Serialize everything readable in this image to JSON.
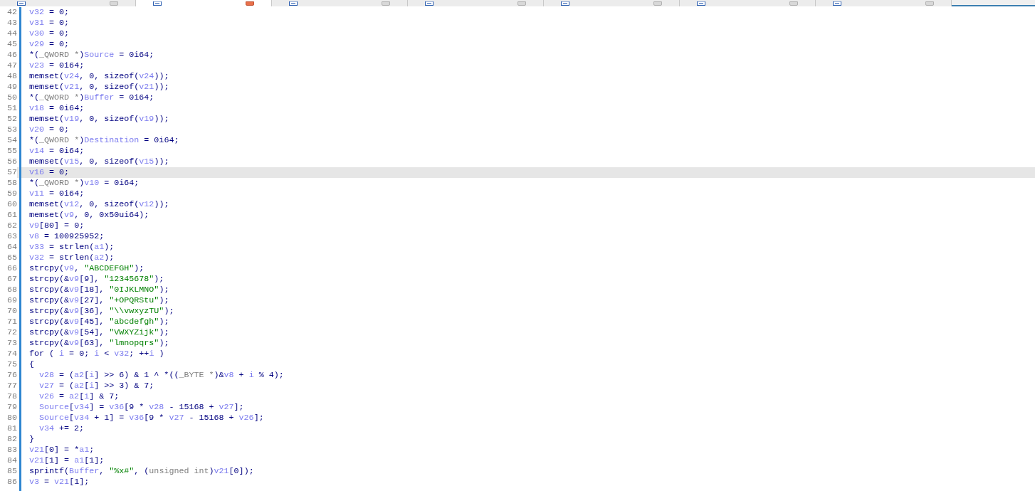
{
  "tabs": [
    {
      "selected": false
    },
    {
      "selected": true
    },
    {
      "selected": false
    },
    {
      "selected": false
    },
    {
      "selected": false
    },
    {
      "selected": false
    },
    {
      "selected": false
    }
  ],
  "lines": [
    {
      "number": "42",
      "highlighted": false,
      "tokens": [
        {
          "kind": "var",
          "text": "v32"
        },
        {
          "kind": "plain",
          "text": " = 0;"
        }
      ]
    },
    {
      "number": "43",
      "highlighted": false,
      "tokens": [
        {
          "kind": "var",
          "text": "v31"
        },
        {
          "kind": "plain",
          "text": " = 0;"
        }
      ]
    },
    {
      "number": "44",
      "highlighted": false,
      "tokens": [
        {
          "kind": "var",
          "text": "v30"
        },
        {
          "kind": "plain",
          "text": " = 0;"
        }
      ]
    },
    {
      "number": "45",
      "highlighted": false,
      "tokens": [
        {
          "kind": "var",
          "text": "v29"
        },
        {
          "kind": "plain",
          "text": " = 0;"
        }
      ]
    },
    {
      "number": "46",
      "highlighted": false,
      "tokens": [
        {
          "kind": "plain",
          "text": "*("
        },
        {
          "kind": "type",
          "text": "_QWORD *"
        },
        {
          "kind": "plain",
          "text": ")"
        },
        {
          "kind": "var",
          "text": "Source"
        },
        {
          "kind": "plain",
          "text": " = 0i64;"
        }
      ]
    },
    {
      "number": "47",
      "highlighted": false,
      "tokens": [
        {
          "kind": "var",
          "text": "v23"
        },
        {
          "kind": "plain",
          "text": " = 0i64;"
        }
      ]
    },
    {
      "number": "48",
      "highlighted": false,
      "tokens": [
        {
          "kind": "plain",
          "text": "memset("
        },
        {
          "kind": "var",
          "text": "v24"
        },
        {
          "kind": "plain",
          "text": ", 0, sizeof("
        },
        {
          "kind": "var",
          "text": "v24"
        },
        {
          "kind": "plain",
          "text": "));"
        }
      ]
    },
    {
      "number": "49",
      "highlighted": false,
      "tokens": [
        {
          "kind": "plain",
          "text": "memset("
        },
        {
          "kind": "var",
          "text": "v21"
        },
        {
          "kind": "plain",
          "text": ", 0, sizeof("
        },
        {
          "kind": "var",
          "text": "v21"
        },
        {
          "kind": "plain",
          "text": "));"
        }
      ]
    },
    {
      "number": "50",
      "highlighted": false,
      "tokens": [
        {
          "kind": "plain",
          "text": "*("
        },
        {
          "kind": "type",
          "text": "_QWORD *"
        },
        {
          "kind": "plain",
          "text": ")"
        },
        {
          "kind": "var",
          "text": "Buffer"
        },
        {
          "kind": "plain",
          "text": " = 0i64;"
        }
      ]
    },
    {
      "number": "51",
      "highlighted": false,
      "tokens": [
        {
          "kind": "var",
          "text": "v18"
        },
        {
          "kind": "plain",
          "text": " = 0i64;"
        }
      ]
    },
    {
      "number": "52",
      "highlighted": false,
      "tokens": [
        {
          "kind": "plain",
          "text": "memset("
        },
        {
          "kind": "var",
          "text": "v19"
        },
        {
          "kind": "plain",
          "text": ", 0, sizeof("
        },
        {
          "kind": "var",
          "text": "v19"
        },
        {
          "kind": "plain",
          "text": "));"
        }
      ]
    },
    {
      "number": "53",
      "highlighted": false,
      "tokens": [
        {
          "kind": "var",
          "text": "v20"
        },
        {
          "kind": "plain",
          "text": " = 0;"
        }
      ]
    },
    {
      "number": "54",
      "highlighted": false,
      "tokens": [
        {
          "kind": "plain",
          "text": "*("
        },
        {
          "kind": "type",
          "text": "_QWORD *"
        },
        {
          "kind": "plain",
          "text": ")"
        },
        {
          "kind": "var",
          "text": "Destination"
        },
        {
          "kind": "plain",
          "text": " = 0i64;"
        }
      ]
    },
    {
      "number": "55",
      "highlighted": false,
      "tokens": [
        {
          "kind": "var",
          "text": "v14"
        },
        {
          "kind": "plain",
          "text": " = 0i64;"
        }
      ]
    },
    {
      "number": "56",
      "highlighted": false,
      "tokens": [
        {
          "kind": "plain",
          "text": "memset("
        },
        {
          "kind": "var",
          "text": "v15"
        },
        {
          "kind": "plain",
          "text": ", 0, sizeof("
        },
        {
          "kind": "var",
          "text": "v15"
        },
        {
          "kind": "plain",
          "text": "));"
        }
      ]
    },
    {
      "number": "57",
      "highlighted": true,
      "tokens": [
        {
          "kind": "var",
          "text": "v16"
        },
        {
          "kind": "plain",
          "text": " = 0;"
        }
      ]
    },
    {
      "number": "58",
      "highlighted": false,
      "tokens": [
        {
          "kind": "plain",
          "text": "*("
        },
        {
          "kind": "type",
          "text": "_QWORD *"
        },
        {
          "kind": "plain",
          "text": ")"
        },
        {
          "kind": "var",
          "text": "v10"
        },
        {
          "kind": "plain",
          "text": " = 0i64;"
        }
      ]
    },
    {
      "number": "59",
      "highlighted": false,
      "tokens": [
        {
          "kind": "var",
          "text": "v11"
        },
        {
          "kind": "plain",
          "text": " = 0i64;"
        }
      ]
    },
    {
      "number": "60",
      "highlighted": false,
      "tokens": [
        {
          "kind": "plain",
          "text": "memset("
        },
        {
          "kind": "var",
          "text": "v12"
        },
        {
          "kind": "plain",
          "text": ", 0, sizeof("
        },
        {
          "kind": "var",
          "text": "v12"
        },
        {
          "kind": "plain",
          "text": "));"
        }
      ]
    },
    {
      "number": "61",
      "highlighted": false,
      "tokens": [
        {
          "kind": "plain",
          "text": "memset("
        },
        {
          "kind": "var",
          "text": "v9"
        },
        {
          "kind": "plain",
          "text": ", 0, 0x50ui64);"
        }
      ]
    },
    {
      "number": "62",
      "highlighted": false,
      "tokens": [
        {
          "kind": "var",
          "text": "v9"
        },
        {
          "kind": "plain",
          "text": "[80] = 0;"
        }
      ]
    },
    {
      "number": "63",
      "highlighted": false,
      "tokens": [
        {
          "kind": "var",
          "text": "v8"
        },
        {
          "kind": "plain",
          "text": " = 100925952;"
        }
      ]
    },
    {
      "number": "64",
      "highlighted": false,
      "tokens": [
        {
          "kind": "var",
          "text": "v33"
        },
        {
          "kind": "plain",
          "text": " = strlen("
        },
        {
          "kind": "var",
          "text": "a1"
        },
        {
          "kind": "plain",
          "text": ");"
        }
      ]
    },
    {
      "number": "65",
      "highlighted": false,
      "tokens": [
        {
          "kind": "var",
          "text": "v32"
        },
        {
          "kind": "plain",
          "text": " = strlen("
        },
        {
          "kind": "var",
          "text": "a2"
        },
        {
          "kind": "plain",
          "text": ");"
        }
      ]
    },
    {
      "number": "66",
      "highlighted": false,
      "tokens": [
        {
          "kind": "plain",
          "text": "strcpy("
        },
        {
          "kind": "var",
          "text": "v9"
        },
        {
          "kind": "plain",
          "text": ", "
        },
        {
          "kind": "str",
          "text": "\"ABCDEFGH\""
        },
        {
          "kind": "plain",
          "text": ");"
        }
      ]
    },
    {
      "number": "67",
      "highlighted": false,
      "tokens": [
        {
          "kind": "plain",
          "text": "strcpy(&"
        },
        {
          "kind": "var",
          "text": "v9"
        },
        {
          "kind": "plain",
          "text": "[9], "
        },
        {
          "kind": "str",
          "text": "\"12345678\""
        },
        {
          "kind": "plain",
          "text": ");"
        }
      ]
    },
    {
      "number": "68",
      "highlighted": false,
      "tokens": [
        {
          "kind": "plain",
          "text": "strcpy(&"
        },
        {
          "kind": "var",
          "text": "v9"
        },
        {
          "kind": "plain",
          "text": "[18], "
        },
        {
          "kind": "str",
          "text": "\"0IJKLMNO\""
        },
        {
          "kind": "plain",
          "text": ");"
        }
      ]
    },
    {
      "number": "69",
      "highlighted": false,
      "tokens": [
        {
          "kind": "plain",
          "text": "strcpy(&"
        },
        {
          "kind": "var",
          "text": "v9"
        },
        {
          "kind": "plain",
          "text": "[27], "
        },
        {
          "kind": "str",
          "text": "\"+OPQRStu\""
        },
        {
          "kind": "plain",
          "text": ");"
        }
      ]
    },
    {
      "number": "70",
      "highlighted": false,
      "tokens": [
        {
          "kind": "plain",
          "text": "strcpy(&"
        },
        {
          "kind": "var",
          "text": "v9"
        },
        {
          "kind": "plain",
          "text": "[36], "
        },
        {
          "kind": "str",
          "text": "\"\\\\vwxyzTU\""
        },
        {
          "kind": "plain",
          "text": ");"
        }
      ]
    },
    {
      "number": "71",
      "highlighted": false,
      "tokens": [
        {
          "kind": "plain",
          "text": "strcpy(&"
        },
        {
          "kind": "var",
          "text": "v9"
        },
        {
          "kind": "plain",
          "text": "[45], "
        },
        {
          "kind": "str",
          "text": "\"abcdefgh\""
        },
        {
          "kind": "plain",
          "text": ");"
        }
      ]
    },
    {
      "number": "72",
      "highlighted": false,
      "tokens": [
        {
          "kind": "plain",
          "text": "strcpy(&"
        },
        {
          "kind": "var",
          "text": "v9"
        },
        {
          "kind": "plain",
          "text": "[54], "
        },
        {
          "kind": "str",
          "text": "\"VWXYZijk\""
        },
        {
          "kind": "plain",
          "text": ");"
        }
      ]
    },
    {
      "number": "73",
      "highlighted": false,
      "tokens": [
        {
          "kind": "plain",
          "text": "strcpy(&"
        },
        {
          "kind": "var",
          "text": "v9"
        },
        {
          "kind": "plain",
          "text": "[63], "
        },
        {
          "kind": "str",
          "text": "\"lmnopqrs\""
        },
        {
          "kind": "plain",
          "text": ");"
        }
      ]
    },
    {
      "number": "74",
      "highlighted": false,
      "tokens": [
        {
          "kind": "plain",
          "text": "for ( "
        },
        {
          "kind": "var",
          "text": "i"
        },
        {
          "kind": "plain",
          "text": " = 0; "
        },
        {
          "kind": "var",
          "text": "i"
        },
        {
          "kind": "plain",
          "text": " < "
        },
        {
          "kind": "var",
          "text": "v32"
        },
        {
          "kind": "plain",
          "text": "; ++"
        },
        {
          "kind": "var",
          "text": "i"
        },
        {
          "kind": "plain",
          "text": " )"
        }
      ]
    },
    {
      "number": "75",
      "highlighted": false,
      "tokens": [
        {
          "kind": "plain",
          "text": "{"
        }
      ]
    },
    {
      "number": "76",
      "highlighted": false,
      "in_block": true,
      "tokens": [
        {
          "kind": "var",
          "text": "v28"
        },
        {
          "kind": "plain",
          "text": " = ("
        },
        {
          "kind": "var",
          "text": "a2"
        },
        {
          "kind": "plain",
          "text": "["
        },
        {
          "kind": "var",
          "text": "i"
        },
        {
          "kind": "plain",
          "text": "] >> 6) & 1 ^ *(("
        },
        {
          "kind": "type",
          "text": "_BYTE *"
        },
        {
          "kind": "plain",
          "text": ")&"
        },
        {
          "kind": "var",
          "text": "v8"
        },
        {
          "kind": "plain",
          "text": " + "
        },
        {
          "kind": "var",
          "text": "i"
        },
        {
          "kind": "plain",
          "text": " % 4);"
        }
      ]
    },
    {
      "number": "77",
      "highlighted": false,
      "in_block": true,
      "tokens": [
        {
          "kind": "var",
          "text": "v27"
        },
        {
          "kind": "plain",
          "text": " = ("
        },
        {
          "kind": "var",
          "text": "a2"
        },
        {
          "kind": "plain",
          "text": "["
        },
        {
          "kind": "var",
          "text": "i"
        },
        {
          "kind": "plain",
          "text": "] >> 3) & 7;"
        }
      ]
    },
    {
      "number": "78",
      "highlighted": false,
      "in_block": true,
      "tokens": [
        {
          "kind": "var",
          "text": "v26"
        },
        {
          "kind": "plain",
          "text": " = "
        },
        {
          "kind": "var",
          "text": "a2"
        },
        {
          "kind": "plain",
          "text": "["
        },
        {
          "kind": "var",
          "text": "i"
        },
        {
          "kind": "plain",
          "text": "] & 7;"
        }
      ]
    },
    {
      "number": "79",
      "highlighted": false,
      "in_block": true,
      "tokens": [
        {
          "kind": "var",
          "text": "Source"
        },
        {
          "kind": "plain",
          "text": "["
        },
        {
          "kind": "var",
          "text": "v34"
        },
        {
          "kind": "plain",
          "text": "] = "
        },
        {
          "kind": "var",
          "text": "v36"
        },
        {
          "kind": "plain",
          "text": "[9 * "
        },
        {
          "kind": "var",
          "text": "v28"
        },
        {
          "kind": "plain",
          "text": " - 15168 + "
        },
        {
          "kind": "var",
          "text": "v27"
        },
        {
          "kind": "plain",
          "text": "];"
        }
      ]
    },
    {
      "number": "80",
      "highlighted": false,
      "in_block": true,
      "tokens": [
        {
          "kind": "var",
          "text": "Source"
        },
        {
          "kind": "plain",
          "text": "["
        },
        {
          "kind": "var",
          "text": "v34"
        },
        {
          "kind": "plain",
          "text": " + 1] = "
        },
        {
          "kind": "var",
          "text": "v36"
        },
        {
          "kind": "plain",
          "text": "[9 * "
        },
        {
          "kind": "var",
          "text": "v27"
        },
        {
          "kind": "plain",
          "text": " - 15168 + "
        },
        {
          "kind": "var",
          "text": "v26"
        },
        {
          "kind": "plain",
          "text": "];"
        }
      ]
    },
    {
      "number": "81",
      "highlighted": false,
      "in_block": true,
      "tokens": [
        {
          "kind": "var",
          "text": "v34"
        },
        {
          "kind": "plain",
          "text": " += 2;"
        }
      ]
    },
    {
      "number": "82",
      "highlighted": false,
      "tokens": [
        {
          "kind": "plain",
          "text": "}"
        }
      ]
    },
    {
      "number": "83",
      "highlighted": false,
      "tokens": [
        {
          "kind": "var",
          "text": "v21"
        },
        {
          "kind": "plain",
          "text": "[0] = *"
        },
        {
          "kind": "var",
          "text": "a1"
        },
        {
          "kind": "plain",
          "text": ";"
        }
      ]
    },
    {
      "number": "84",
      "highlighted": false,
      "tokens": [
        {
          "kind": "var",
          "text": "v21"
        },
        {
          "kind": "plain",
          "text": "[1] = "
        },
        {
          "kind": "var",
          "text": "a1"
        },
        {
          "kind": "plain",
          "text": "[1];"
        }
      ]
    },
    {
      "number": "85",
      "highlighted": false,
      "tokens": [
        {
          "kind": "plain",
          "text": "sprintf("
        },
        {
          "kind": "var",
          "text": "Buffer"
        },
        {
          "kind": "plain",
          "text": ", "
        },
        {
          "kind": "str",
          "text": "\"%x#\""
        },
        {
          "kind": "plain",
          "text": ", ("
        },
        {
          "kind": "type",
          "text": "unsigned int"
        },
        {
          "kind": "plain",
          "text": ")"
        },
        {
          "kind": "var",
          "text": "v21"
        },
        {
          "kind": "plain",
          "text": "[0]);"
        }
      ]
    },
    {
      "number": "86",
      "highlighted": false,
      "tokens": [
        {
          "kind": "var",
          "text": "v3"
        },
        {
          "kind": "plain",
          "text": " = "
        },
        {
          "kind": "var",
          "text": "v21"
        },
        {
          "kind": "plain",
          "text": "[1];"
        }
      ]
    }
  ]
}
